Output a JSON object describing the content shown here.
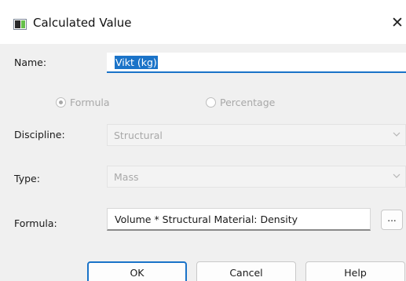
{
  "window": {
    "title": "Calculated Value",
    "close_glyph": "✕"
  },
  "form": {
    "name_label": "Name:",
    "name_value": "Vikt (kg)",
    "radio_formula": "Formula",
    "radio_percentage": "Percentage",
    "selected_mode": "Formula",
    "discipline_label": "Discipline:",
    "discipline_value": "Structural",
    "type_label": "Type:",
    "type_value": "Mass",
    "formula_label": "Formula:",
    "formula_value": "Volume * Structural Material: Density",
    "formula_browse": "..."
  },
  "buttons": {
    "ok": "OK",
    "cancel": "Cancel",
    "help": "Help"
  },
  "colors": {
    "accent": "#1a73c8",
    "disabled_text": "#a8a8a8",
    "dialog_bg": "#f0f0f0"
  },
  "icons": [
    "app-icon",
    "close-icon",
    "chevron-down-icon",
    "radio-icon"
  ]
}
